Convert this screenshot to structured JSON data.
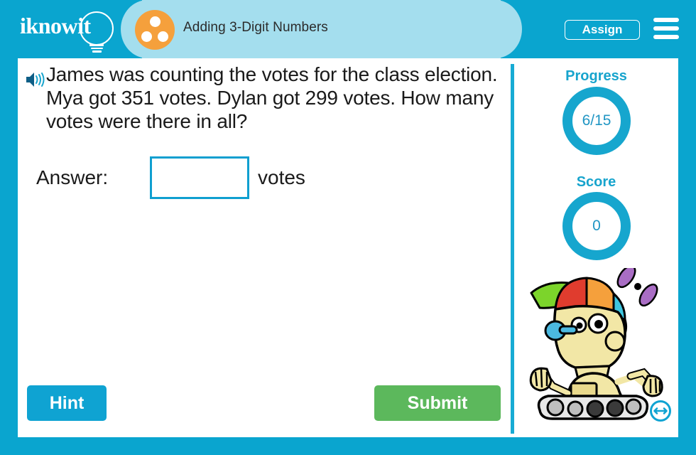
{
  "header": {
    "logo_text": "iknowit",
    "logo_icon": "lightbulb-icon",
    "subject_icon": "three-dots-circle-icon",
    "title": "Adding 3-Digit Numbers",
    "assign_label": "Assign",
    "menu_icon": "hamburger-menu-icon",
    "bg_color": "#0AA5CF",
    "tab_color": "#A4DEEE",
    "subject_icon_color": "#F5A03C"
  },
  "question": {
    "audio_icon": "speaker-icon",
    "text": "James was counting the votes for the class election. Mya got 351 votes. Dylan got 299 votes. How many votes were there in all?",
    "answer_label": "Answer:",
    "answer_value": "",
    "answer_placeholder": "",
    "answer_unit": "votes"
  },
  "actions": {
    "hint_label": "Hint",
    "hint_color": "#0FA3D2",
    "submit_label": "Submit",
    "submit_color": "#5CB85C"
  },
  "stats": {
    "progress_label": "Progress",
    "progress_value": "6/15",
    "score_label": "Score",
    "score_value": "0",
    "ring_color": "#16A6CE",
    "mascot_icon": "robot-mascot-propeller-hat",
    "resize_icon": "horizontal-resize-arrow-icon"
  }
}
